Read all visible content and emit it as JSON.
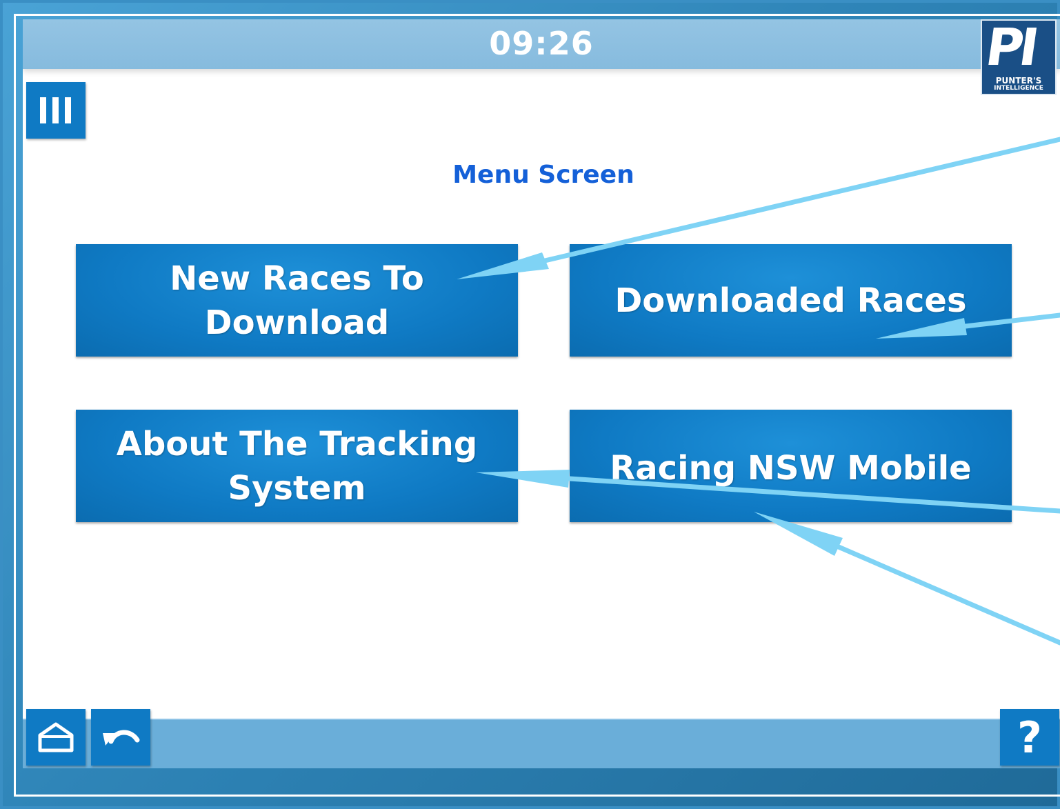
{
  "header": {
    "time": "09:26",
    "logo": {
      "letters": "PI",
      "text_line1": "PUNTER'S",
      "text_line2": "INTELLIGENCE"
    }
  },
  "page": {
    "title": "Menu Screen"
  },
  "buttons": {
    "new_races": "New Races To Download",
    "downloaded_races": "Downloaded Races",
    "about_tracking_line1": "About The Tracking",
    "about_tracking_line2": "System",
    "racing_nsw": "Racing NSW Mobile"
  },
  "footer": {
    "help_label": "?"
  },
  "icons": {
    "menu": "menu-icon",
    "home": "home-icon",
    "back": "back-icon",
    "help": "help-icon"
  },
  "colors": {
    "accent": "#0f7ac4",
    "title": "#1460d8",
    "top_bar": "#8dc0e1",
    "bottom_bar": "#6aaed9",
    "annotation_arrow": "#7fd3f5"
  }
}
